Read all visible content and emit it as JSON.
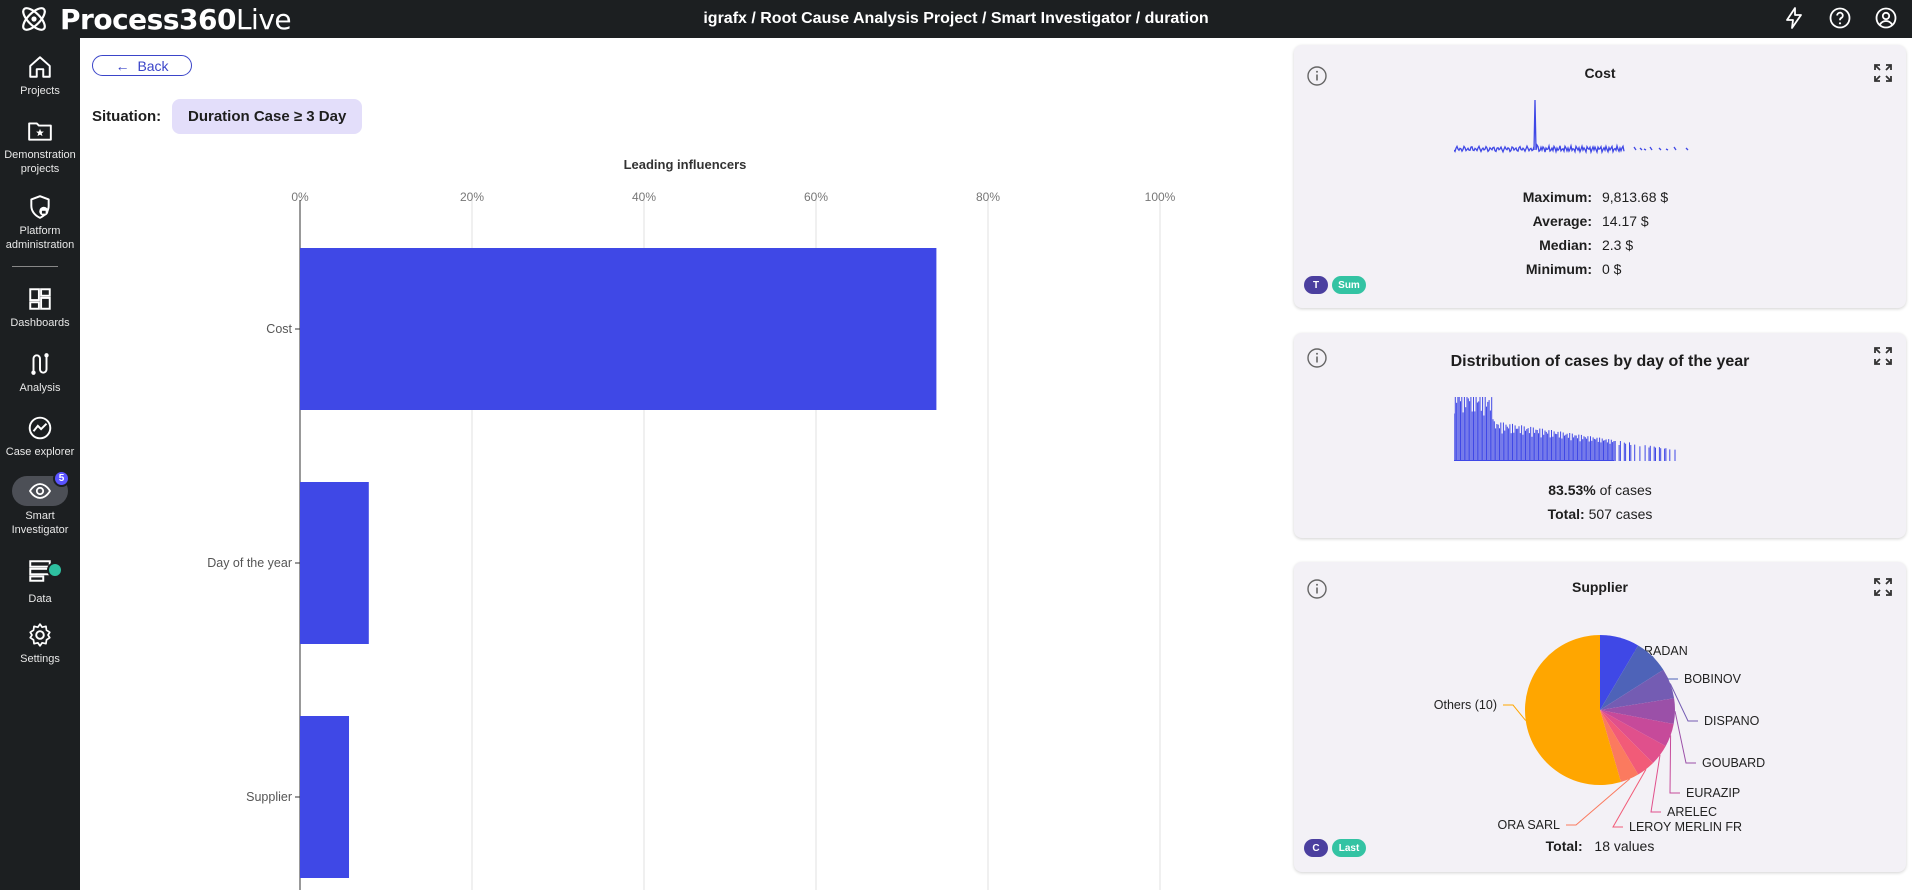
{
  "app": {
    "logo_bold": "Process360",
    "logo_light": "Live",
    "breadcrumb": "igrafx / Root Cause Analysis Project / Smart Investigator / duration"
  },
  "sidebar": {
    "items": [
      {
        "label": "Projects",
        "icon": "home-icon"
      },
      {
        "label": "Demonstration projects",
        "icon": "folder-star-icon"
      },
      {
        "label": "Platform administration",
        "icon": "shield-lock-icon"
      },
      {
        "label": "Dashboards",
        "icon": "dashboard-icon"
      },
      {
        "label": "Analysis",
        "icon": "analysis-icon"
      },
      {
        "label": "Case explorer",
        "icon": "case-explorer-icon"
      },
      {
        "label": "Smart Investigator",
        "icon": "eye-search-icon",
        "badge": "5"
      },
      {
        "label": "Data",
        "icon": "data-icon"
      },
      {
        "label": "Settings",
        "icon": "gear-icon"
      }
    ]
  },
  "main": {
    "back_label": "Back",
    "situation_label": "Situation:",
    "situation_value": "Duration Case ≥ 3 Day"
  },
  "chart_data": {
    "type": "bar",
    "orientation": "horizontal",
    "title": "Leading influencers",
    "categories": [
      "Cost",
      "Day of the year",
      "Supplier"
    ],
    "values": [
      74,
      8,
      5.7
    ],
    "xlim": [
      0,
      100
    ],
    "xticks": [
      "0%",
      "20%",
      "40%",
      "60%",
      "80%",
      "100%"
    ],
    "bar_color": "#3f48e6",
    "grid": true
  },
  "cards": {
    "cost": {
      "title": "Cost",
      "stats": [
        {
          "label": "Maximum:",
          "value": "9,813.68 $"
        },
        {
          "label": "Average:",
          "value": "14.17 $"
        },
        {
          "label": "Median:",
          "value": "2.3 $"
        },
        {
          "label": "Minimum:",
          "value": "0 $"
        }
      ],
      "pill_t": "T",
      "pill_agg": "Sum"
    },
    "distribution": {
      "title": "Distribution of cases by day of the year",
      "percent": "83.53%",
      "percent_suffix": "of cases",
      "total_label": "Total:",
      "total_value": "507 cases"
    },
    "supplier": {
      "title": "Supplier",
      "total_label": "Total:",
      "total_value": "18 values",
      "pill_c": "C",
      "pill_agg": "Last",
      "slices": [
        {
          "label": "RADAN",
          "value": 8.5,
          "color": "#3f48e6"
        },
        {
          "label": "BOBINOV",
          "value": 7.5,
          "color": "#4e63b8"
        },
        {
          "label": "DISPANO",
          "value": 6.5,
          "color": "#745cb3"
        },
        {
          "label": "GOUBARD",
          "value": 5.5,
          "color": "#9b50a8"
        },
        {
          "label": "EURAZIP",
          "value": 5,
          "color": "#c64a9a"
        },
        {
          "label": "ARELEC",
          "value": 4.5,
          "color": "#e0508c"
        },
        {
          "label": "LEROY MERLIN FR",
          "value": 4,
          "color": "#f25b78"
        },
        {
          "label": "ORA SARL",
          "value": 4,
          "color": "#fb7a5f"
        },
        {
          "label": "Others (10)",
          "value": 54.5,
          "color": "#ffa600"
        }
      ]
    }
  },
  "colors": {
    "accent": "#3f48e6",
    "topbar": "#1c1f21",
    "chip": "#e3defa"
  }
}
